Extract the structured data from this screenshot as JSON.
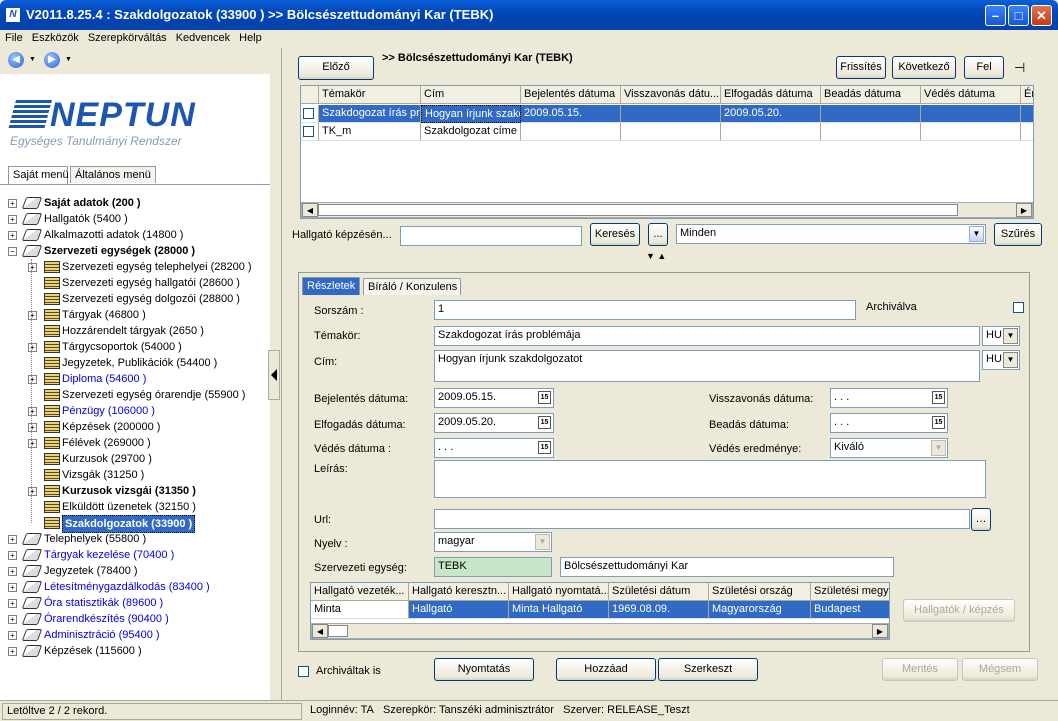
{
  "window": {
    "title": "V2011.8.25.4 : Szakdolgozatok (33900  )  >> Bölcsészettudományi Kar (TEBK)"
  },
  "menu": [
    "File",
    "Eszközök",
    "Szerepkörváltás",
    "Kedvencek",
    "Help"
  ],
  "logo": {
    "brand": "NEPTUN",
    "tagline": "Egységes Tanulmányi Rendszer"
  },
  "left_tabs": [
    "Saját menü",
    "Általános menü"
  ],
  "tree": [
    {
      "label": "Saját adatok (200  )",
      "level": 0,
      "bold": true,
      "blue": false
    },
    {
      "label": "Hallgatók (5400  )",
      "level": 0,
      "bold": false,
      "blue": false
    },
    {
      "label": "Alkalmazotti adatok (14800  )",
      "level": 0,
      "bold": false,
      "blue": false
    },
    {
      "label": "Szervezeti egységek (28000  )",
      "level": 0,
      "bold": true,
      "blue": false,
      "open": true
    },
    {
      "label": "Szervezeti egység telephelyei (28200  )",
      "level": 1
    },
    {
      "label": "Szervezeti egység hallgatói (28600  )",
      "level": 1
    },
    {
      "label": "Szervezeti egység dolgozói (28800  )",
      "level": 1
    },
    {
      "label": "Tárgyak (46800  )",
      "level": 1
    },
    {
      "label": "Hozzárendelt tárgyak (2650  )",
      "level": 1
    },
    {
      "label": "Tárgycsoportok (54000  )",
      "level": 1
    },
    {
      "label": "Jegyzetek, Publikációk (54400  )",
      "level": 1
    },
    {
      "label": "Diploma (54600  )",
      "level": 1,
      "blue": true
    },
    {
      "label": "Szervezeti egység órarendje (55900  )",
      "level": 1
    },
    {
      "label": "Pénzügy (106000  )",
      "level": 1,
      "blue": true
    },
    {
      "label": "Képzések (200000  )",
      "level": 1
    },
    {
      "label": "Félévek (269000  )",
      "level": 1
    },
    {
      "label": "Kurzusok (29700  )",
      "level": 1
    },
    {
      "label": "Vizsgák (31250  )",
      "level": 1
    },
    {
      "label": "Kurzusok vizsgái (31350  )",
      "level": 1,
      "bold": true
    },
    {
      "label": "Elküldött üzenetek (32150  )",
      "level": 1
    },
    {
      "label": "Szakdolgozatok (33900  )",
      "level": 1,
      "selected": true
    },
    {
      "label": "Telephelyek (55800  )",
      "level": 0
    },
    {
      "label": "Tárgyak kezelése (70400  )",
      "level": 0,
      "blue": true
    },
    {
      "label": "Jegyzetek (78400  )",
      "level": 0
    },
    {
      "label": "Létesítménygazdálkodás (83400  )",
      "level": 0,
      "blue": true
    },
    {
      "label": "Óra statisztikák (89600  )",
      "level": 0,
      "blue": true
    },
    {
      "label": "Órarendkészítés (90400  )",
      "level": 0,
      "blue": true
    },
    {
      "label": "Adminisztráció (95400  )",
      "level": 0,
      "blue": true
    },
    {
      "label": "Képzések (115600  )",
      "level": 0
    }
  ],
  "toolbar": {
    "prev": "Előző",
    "breadcrumb": ">> Bölcsészettudományi Kar (TEBK)",
    "refresh": "Frissítés",
    "next": "Következő",
    "up": "Fel"
  },
  "main_grid": {
    "headers": [
      "Témakör",
      "Cím",
      "Bejelentés dátuma",
      "Visszavonás dátu...",
      "Elfogadás dátuma",
      "Beadás dátuma",
      "Védés dátuma",
      "Ér"
    ],
    "rows": [
      [
        "Szakdogozat írás pr",
        "Hogyan írjunk szakc",
        "2009.05.15.",
        "",
        "2009.05.20.",
        "",
        "",
        ""
      ],
      [
        "TK_m",
        "Szakdolgozat címe",
        "",
        "",
        "",
        "",
        "",
        ""
      ]
    ]
  },
  "search": {
    "label": "Hallgató képzésén...",
    "value": "",
    "search_btn": "Keresés",
    "dots": "...",
    "filter": "Minden",
    "filter_btn": "Szűrés"
  },
  "detail_tabs": [
    "Részletek",
    "Bíráló / Konzulens"
  ],
  "form": {
    "sorszam_label": "Sorszám :",
    "sorszam": "1",
    "archivalva_label": "Archiválva",
    "temakor_label": "Témakör:",
    "temakor": "Szakdogozat írás problémája",
    "temakor_lang": "HU",
    "cim_label": "Cím:",
    "cim": "Hogyan írjunk szakdolgozatot",
    "cim_lang": "HU",
    "bejelentes_label": "Bejelentés dátuma:",
    "bejelentes": "2009.05.15.",
    "visszavonas_label": "Visszavonás dátuma:",
    "visszavonas": " .  .  .",
    "elfogadas_label": "Elfogadás dátuma:",
    "elfogadas": "2009.05.20.",
    "beadas_label": "Beadás dátuma:",
    "beadas": " .  .  .",
    "vedes_label": "Védés dátuma :",
    "vedes": " .  .  .",
    "vedes_eredmeny_label": "Védés eredménye:",
    "vedes_eredmeny": "Kiváló",
    "leiras_label": "Leírás:",
    "leiras": "",
    "url_label": "Url:",
    "url": "",
    "nyelv_label": "Nyelv :",
    "nyelv": "magyar",
    "szerv_label": "Szervezeti egység:",
    "szerv_code": "TEBK",
    "szerv_name": "Bölcsészettudományi Kar",
    "cal_glyph": "15"
  },
  "student_grid": {
    "headers": [
      "Hallgató vezeték...",
      "Hallgató keresztn...",
      "Hallgató nyomtatá...",
      "Születési dátum",
      "Születési ország",
      "Születési megye"
    ],
    "rows": [
      [
        "Minta",
        "Hallgató",
        "Minta  Hallgató",
        "1969.08.09.",
        "Magyarország",
        "Budapest"
      ]
    ],
    "btn": "Hallgatók / képzés"
  },
  "bottom": {
    "archived_label": "Archiváltak is",
    "print": "Nyomtatás",
    "add": "Hozzáad",
    "edit": "Szerkeszt",
    "save": "Mentés",
    "cancel": "Mégsem"
  },
  "status": {
    "records": "Letöltve 2 / 2 rekord.",
    "login": "Loginnév: TA",
    "role": "Szerepkör: Tanszéki adminisztrátor",
    "server": "Szerver: RELEASE_Teszt"
  },
  "colors": {
    "titlebar": "#0347b7",
    "selection": "#316ac5",
    "brand": "#1c56b0"
  }
}
